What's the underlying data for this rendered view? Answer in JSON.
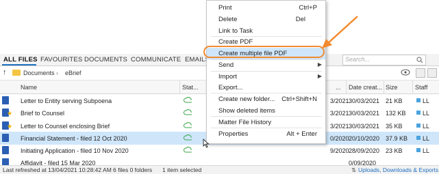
{
  "tabs": [
    "ALL FILES",
    "FAVOURITES",
    "DOCUMENTS",
    "COMMUNICATE",
    "EMAILS"
  ],
  "search": {
    "placeholder": "Search..."
  },
  "breadcrumb": [
    "Documents",
    "eBrief"
  ],
  "columns": {
    "name": "Name",
    "status": "Stat...",
    "date_modified": "...",
    "date_created": "Date creat...",
    "size": "Size",
    "staff": "Staff"
  },
  "rows": [
    {
      "name": "Letter to Entity serving Subpoena",
      "modified": "3/2021",
      "created": "30/03/2021",
      "size": "21 KB",
      "staff": "LL",
      "selected": false
    },
    {
      "name": "Brief to Counsel",
      "modified": "3/2021",
      "created": "30/03/2021",
      "size": "132 KB",
      "staff": "LL",
      "selected": false
    },
    {
      "name": "Letter to Counsel enclosing Brief",
      "modified": "3/2021",
      "created": "30/03/2021",
      "size": "35 KB",
      "staff": "LL",
      "selected": false
    },
    {
      "name": "Financial Statement - filed 12 Oct 2020",
      "modified": "0/2020",
      "created": "20/10/2020",
      "size": "37.9 KB",
      "staff": "LL",
      "selected": true
    },
    {
      "name": "Initiating Application - filed 10 Nov 2020",
      "modified": "9/2020",
      "created": "28/09/2020",
      "size": "23 KB",
      "staff": "LL",
      "selected": false
    },
    {
      "name": "Affidavit - filed 15 Mar 2020",
      "modified": "",
      "created": "0/09/2020",
      "size": "",
      "staff": "",
      "selected": false
    }
  ],
  "status": {
    "refresh": "Last refreshed at 13/04/2021 10:28:42 AM",
    "counts": "6 files  0 folders",
    "selected": "1 item selected",
    "uploads": "Uploads, Downloads & Exports"
  },
  "menu": {
    "print": {
      "label": "Print",
      "shortcut": "Ctrl+P"
    },
    "delete": {
      "label": "Delete",
      "shortcut": "Del"
    },
    "link_task": {
      "label": "Link to Task"
    },
    "create_pdf": {
      "label": "Create PDF"
    },
    "create_multi_pdf": {
      "label": "Create multiple file PDF"
    },
    "send": {
      "label": "Send"
    },
    "import": {
      "label": "Import"
    },
    "export": {
      "label": "Export..."
    },
    "new_folder": {
      "label": "Create new folder...",
      "shortcut": "Ctrl+Shift+N"
    },
    "show_deleted": {
      "label": "Show deleted items"
    },
    "history": {
      "label": "Matter File History"
    },
    "properties": {
      "label": "Properties",
      "shortcut": "Alt + Enter"
    }
  },
  "colors": {
    "accent": "#1e6fc0",
    "highlight_ring": "#f28a2e",
    "selected_row": "#cfe6fa"
  }
}
